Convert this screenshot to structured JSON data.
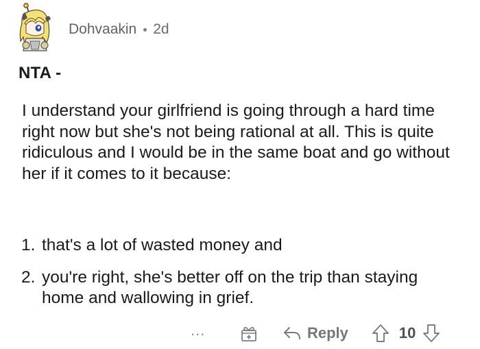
{
  "comment": {
    "username": "Dohvaakin",
    "separator": "•",
    "age": "2d",
    "title": "NTA -",
    "paragraph": "I understand your girlfriend is going through a hard time right now but she's not being rational at all. This is quite ridiculous and I would be in the same boat and go without her if it comes to it because:",
    "list": [
      {
        "num": "1.",
        "text": "that's a lot of wasted money and"
      },
      {
        "num": "2.",
        "text": "you're right, she's better off on the trip than staying home and wallowing in grief."
      }
    ]
  },
  "actions": {
    "more_label": "...",
    "reply_label": "Reply",
    "score": "10"
  },
  "icons": {
    "avatar": "anime-avatar-icon",
    "award": "gift-icon",
    "reply": "reply-arrow-icon",
    "upvote": "upvote-arrow-icon",
    "downvote": "downvote-arrow-icon"
  },
  "colors": {
    "text": "#1a1a1b",
    "meta": "#6a6d70",
    "icon": "#7a7d80"
  }
}
